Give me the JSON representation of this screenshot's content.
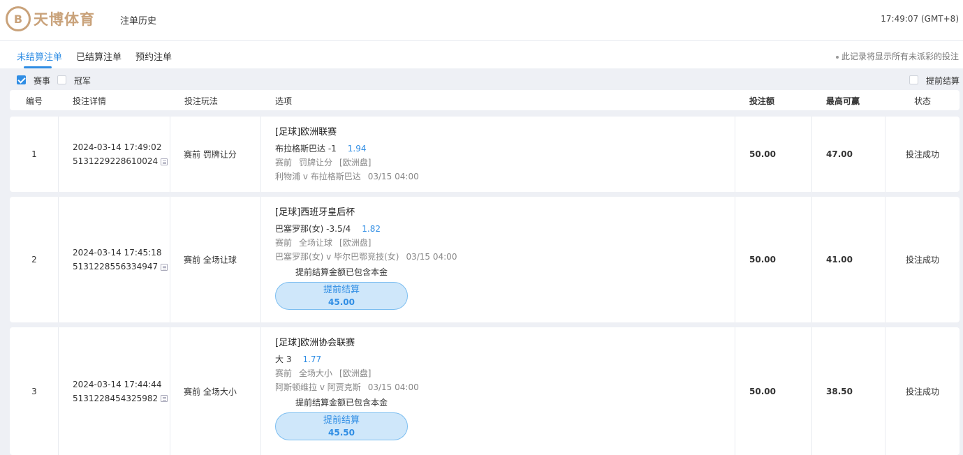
{
  "header": {
    "logo_mark": "B",
    "logo_text": "天博体育",
    "page_title": "注单历史",
    "clock": "17:49:07 (GMT+8)"
  },
  "tabs": [
    {
      "label": "未结算注单",
      "active": true
    },
    {
      "label": "已结算注单",
      "active": false
    },
    {
      "label": "预约注单",
      "active": false
    }
  ],
  "note": "此记录将显示所有未派彩的投注",
  "filters": {
    "match_label": "赛事",
    "match_checked": true,
    "champion_label": "冠军",
    "champion_checked": false,
    "early_label": "提前结算",
    "early_checked": false
  },
  "columns": {
    "no": "编号",
    "detail": "投注详情",
    "type": "投注玩法",
    "option": "选项",
    "stake": "投注额",
    "max_win": "最高可赢",
    "status": "状态"
  },
  "bets": [
    {
      "no": "1",
      "time": "2024-03-14 17:49:02",
      "id": "5131229228610024",
      "type": "赛前 罚牌让分",
      "league": "[足球]欧洲联赛",
      "selection": "布拉格斯巴达 -1",
      "odds": "1.94",
      "meta": [
        "赛前",
        "罚牌让分",
        "[欧洲盘]"
      ],
      "match": "利物浦 v 布拉格斯巴达",
      "match_time": "03/15 04:00",
      "cashout_note": "",
      "cashout_label": "",
      "cashout_value": "",
      "stake": "50.00",
      "max_win": "47.00",
      "status": "投注成功"
    },
    {
      "no": "2",
      "time": "2024-03-14 17:45:18",
      "id": "5131228556334947",
      "type": "赛前 全场让球",
      "league": "[足球]西班牙皇后杯",
      "selection": "巴塞罗那(女) -3.5/4",
      "odds": "1.82",
      "meta": [
        "赛前",
        "全场让球",
        "[欧洲盘]"
      ],
      "match": "巴塞罗那(女) v 毕尔巴鄂竞技(女)",
      "match_time": "03/15 04:00",
      "cashout_note": "提前结算金额已包含本金",
      "cashout_label": "提前结算",
      "cashout_value": "45.00",
      "stake": "50.00",
      "max_win": "41.00",
      "status": "投注成功"
    },
    {
      "no": "3",
      "time": "2024-03-14 17:44:44",
      "id": "5131228454325982",
      "type": "赛前 全场大小",
      "league": "[足球]欧洲协会联赛",
      "selection": "大 3",
      "odds": "1.77",
      "meta": [
        "赛前",
        "全场大小",
        "[欧洲盘]"
      ],
      "match": "阿斯顿维拉 v 阿贾克斯",
      "match_time": "03/15 04:00",
      "cashout_note": "提前结算金额已包含本金",
      "cashout_label": "提前结算",
      "cashout_value": "45.50",
      "stake": "50.00",
      "max_win": "38.50",
      "status": "投注成功"
    }
  ]
}
